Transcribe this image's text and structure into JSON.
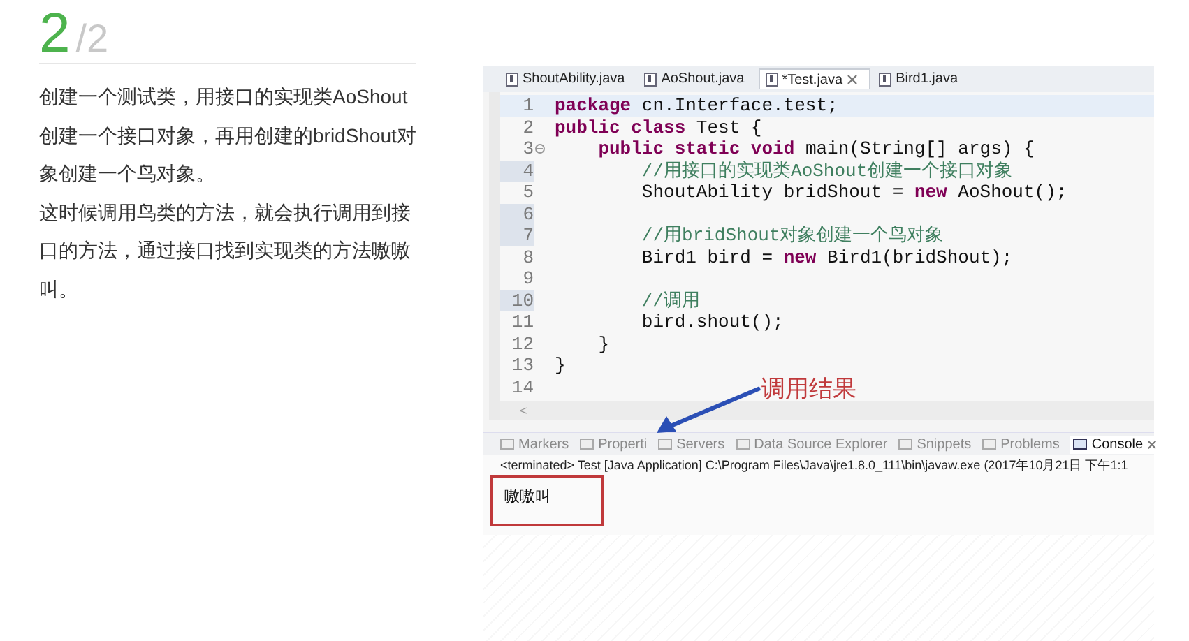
{
  "step": {
    "number": "2",
    "total": "/2"
  },
  "paragraphs": [
    "创建一个测试类，用接口的实现类AoShout创建一个接口对象，再用创建的bridShout对象创建一个鸟对象。",
    "这时候调用鸟类的方法，就会执行调用到接口的方法，通过接口找到实现类的方法嗷嗷叫。"
  ],
  "editor_tabs": [
    {
      "label": "ShoutAbility.java",
      "selected": false
    },
    {
      "label": "AoShout.java",
      "selected": false
    },
    {
      "label": "*Test.java",
      "selected": true
    },
    {
      "label": "Bird1.java",
      "selected": false
    }
  ],
  "code_lines": [
    {
      "number": "1",
      "current": true,
      "marked": false,
      "fold": false,
      "segments": [
        {
          "kind": "keyword",
          "text": "package"
        },
        {
          "kind": "plain",
          "text": " cn.Interface.test;"
        }
      ]
    },
    {
      "number": "2",
      "current": false,
      "marked": false,
      "fold": false,
      "segments": [
        {
          "kind": "keyword",
          "text": "public class"
        },
        {
          "kind": "plain",
          "text": " Test {"
        }
      ]
    },
    {
      "number": "3",
      "current": false,
      "marked": false,
      "fold": true,
      "segments": [
        {
          "kind": "keyword",
          "text": "    public static void"
        },
        {
          "kind": "plain",
          "text": " main(String[] args) {"
        }
      ]
    },
    {
      "number": "4",
      "current": false,
      "marked": true,
      "fold": false,
      "segments": [
        {
          "kind": "comment",
          "text": "        //用接口的实现类AoShout创建一个接口对象"
        }
      ]
    },
    {
      "number": "5",
      "current": false,
      "marked": false,
      "fold": false,
      "segments": [
        {
          "kind": "plain",
          "text": "        ShoutAbility bridShout = "
        },
        {
          "kind": "keyword",
          "text": "new"
        },
        {
          "kind": "plain",
          "text": " AoShout();"
        }
      ]
    },
    {
      "number": "6",
      "current": false,
      "marked": true,
      "fold": false
    },
    {
      "number": "7",
      "current": false,
      "marked": true,
      "fold": false,
      "segments": [
        {
          "kind": "comment",
          "text": "        //用bridShout对象创建一个鸟对象"
        }
      ]
    },
    {
      "number": "8",
      "current": false,
      "marked": false,
      "fold": false,
      "segments": [
        {
          "kind": "plain",
          "text": "        Bird1 bird = "
        },
        {
          "kind": "keyword",
          "text": "new"
        },
        {
          "kind": "plain",
          "text": " Bird1(bridShout);"
        }
      ]
    },
    {
      "number": "9",
      "current": false,
      "marked": false,
      "fold": false
    },
    {
      "number": "10",
      "current": false,
      "marked": true,
      "fold": false,
      "segments": [
        {
          "kind": "comment",
          "text": "        //调用"
        }
      ]
    },
    {
      "number": "11",
      "current": false,
      "marked": false,
      "fold": false,
      "segments": [
        {
          "kind": "plain",
          "text": "        bird.shout();"
        }
      ]
    },
    {
      "number": "12",
      "current": false,
      "marked": false,
      "fold": false,
      "segments": [
        {
          "kind": "plain",
          "text": "    }"
        }
      ]
    },
    {
      "number": "13",
      "current": false,
      "marked": false,
      "fold": false,
      "segments": [
        {
          "kind": "plain",
          "text": "}"
        }
      ]
    },
    {
      "number": "14",
      "current": false,
      "marked": false,
      "fold": false
    }
  ],
  "scroll_arrow": "<",
  "panel_tabs": [
    {
      "label": "Markers",
      "selected": false
    },
    {
      "label": "Properti",
      "selected": false
    },
    {
      "label": "Servers",
      "selected": false
    },
    {
      "label": "Data Source Explorer",
      "selected": false
    },
    {
      "label": "Snippets",
      "selected": false
    },
    {
      "label": "Problems",
      "selected": false
    },
    {
      "label": "Console",
      "selected": true
    }
  ],
  "console_header": "<terminated> Test [Java Application] C:\\Program Files\\Java\\jre1.8.0_111\\bin\\javaw.exe (2017年10月21日 下午1:1",
  "console_output": "嗷嗷叫",
  "annotation": "调用结果"
}
